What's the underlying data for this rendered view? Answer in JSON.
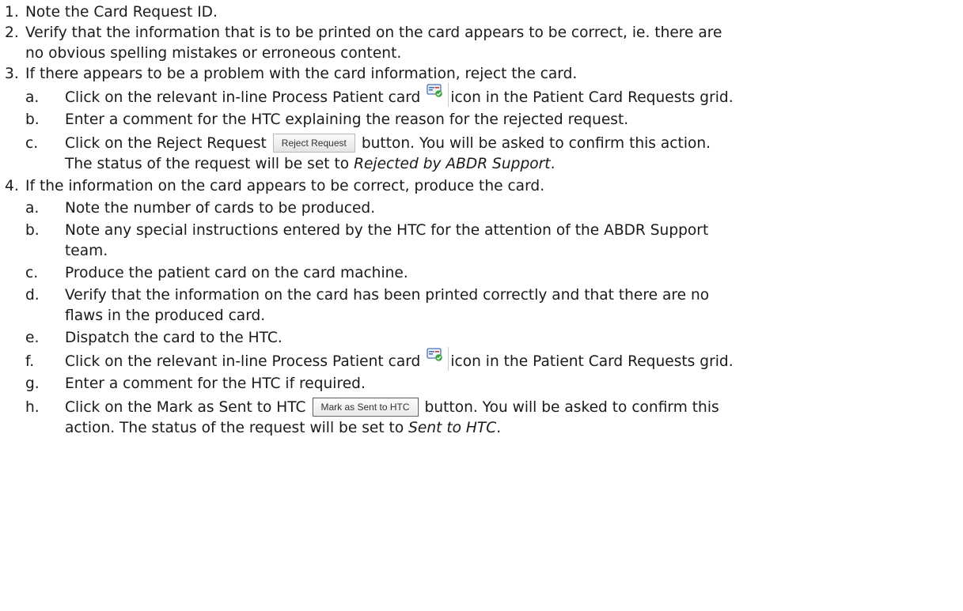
{
  "steps": [
    {
      "num": "1.",
      "text": "Note the Card Request ID."
    },
    {
      "num": "2.",
      "text": "Verify that the information that is to be printed on the card appears to be correct, ie. there are",
      "cont": "no obvious spelling mistakes or erroneous content."
    },
    {
      "num": "3.",
      "text": "If there appears to be a problem with the card information, reject the card.",
      "sub": [
        {
          "letter": "a.",
          "pre": "Click on the relevant in-line Process Patient card",
          "post": "icon in the Patient Card Requests grid."
        },
        {
          "letter": "b.",
          "text": "Enter a comment for the HTC explaining the reason for the rejected request."
        },
        {
          "letter": "c.",
          "pre": "Click on the Reject Request",
          "button": "Reject Request",
          "post": "button. You will be asked to confirm this action.",
          "cont_pre": "The status of the request will be set to",
          "cont_ital": "Rejected by ABDR Support",
          "cont_post": "."
        }
      ]
    },
    {
      "num": "4.",
      "text": "If the information on the card appears to be correct, produce the card.",
      "sub": [
        {
          "letter": "a.",
          "text": "Note the number of cards to be produced."
        },
        {
          "letter": "b.",
          "text": "Note any special instructions entered by the HTC for the attention of the ABDR Support",
          "cont": "team."
        },
        {
          "letter": "c.",
          "text": "Produce the patient card on the card machine."
        },
        {
          "letter": "d.",
          "text": "Verify that the information on the card has been printed correctly and that there are no",
          "cont": "flaws in the produced card."
        },
        {
          "letter": "e.",
          "text": "Dispatch the card to the HTC."
        },
        {
          "letter": "f.",
          "pre": "Click on the relevant in-line Process Patient card",
          "post": "icon in the Patient Card Requests grid."
        },
        {
          "letter": "g.",
          "text": "Enter a comment for the HTC if required."
        },
        {
          "letter": "h.",
          "pre": "Click on the Mark as Sent to HTC",
          "button": "Mark as Sent to HTC",
          "post": "button. You will be asked to confirm this",
          "cont_pre": "action. The status of the request will be set to",
          "cont_ital": "Sent to HTC",
          "cont_post": "."
        }
      ]
    }
  ],
  "icons": {
    "process_card": "process-patient-card-icon"
  },
  "colors": {
    "icon_card": "#4a6fb5",
    "icon_check": "#3aa53a"
  }
}
